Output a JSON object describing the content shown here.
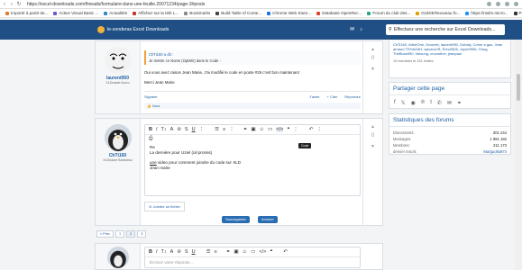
{
  "browser": {
    "url": "https://excel-downloads.com/threads/formulaire-dans-une-feuille.20071234/page-3#posts",
    "bookmarks": [
      {
        "label": "Importé à partir de...",
        "color": "#e07b2b"
      },
      {
        "label": "Active Visual Basic ...",
        "color": "#6a5acd"
      },
      {
        "label": "Actualités",
        "color": "#2d89c9"
      },
      {
        "label": "Affichez sur la télé L...",
        "color": "#c0392b"
      },
      {
        "label": "Bookmarks",
        "color": "#888888"
      },
      {
        "label": "Build Table of Conte...",
        "color": "#444444"
      },
      {
        "label": "Chrome Web Store...",
        "color": "#1a73e8"
      },
      {
        "label": "Database OpenRec...",
        "color": "#d43"
      },
      {
        "label": "Forum du club des...",
        "color": "#2a8"
      },
      {
        "label": "GUIDE/Nouveau fo...",
        "color": "#e2a300"
      },
      {
        "label": "https://mslm.micro...",
        "color": "#1e90ff"
      },
      {
        "label": "Professional Guide...",
        "color": "#333333"
      }
    ]
  },
  "header": {
    "site_name": "le-sonderas Excel Downloads",
    "search_placeholder": "Effectuez une recherche sur Excel Downloads..."
  },
  "post1": {
    "username": "laurent950",
    "user_title": "XLDnaute Accro",
    "quote_header": "ChTi160 a dit :",
    "quote_line1": "Je mettre ce Noms (OptMir) dans le Code :",
    "line2": "Oui vous avez raison Jean Marie, J'ai modifié le code en poste #26 c'est bon maintenant",
    "line3": "Merci Jean Marie",
    "actions": {
      "report": "Signaler",
      "like": "J'aime",
      "quote": "+ Citer",
      "reply": "Répondre"
    },
    "reaction": "Vous",
    "votes": "0"
  },
  "post2": {
    "username": "ChTi160",
    "user_title": "XLDnaute Barbatruc",
    "tooltip": "Code",
    "lines": [
      "Re",
      "La dernière pour Uziel (oil promis)",
      "",
      "une video pour comment joindre du code sur XLD",
      "Jean marie"
    ],
    "link_text": "une",
    "attach": "Joindre un fichier",
    "save": "Sauvegarder",
    "cancel": "Annuler",
    "votes": "0"
  },
  "pager": [
    "« Préc",
    "1",
    "2",
    "3"
  ],
  "reply_box": {
    "placeholder": "Écrivez votre réponse..."
  },
  "sidebar": {
    "members_online_text": "ChTi160, ArtheOne, Dranreb, laurent950, Dubaly, Corne a gaz, Jean arnaud TEHAZAH, sylvanu78, Erez2828, Jujue9956, Gnug, TheBoss990, hieoung, crocrotine, jeanpaul",
    "members_count": "19 membres et 151 invités",
    "share_title": "Partager cette page",
    "stats_title": "Statistiques des forums",
    "stats": [
      {
        "k": "Discussions:",
        "v": "301 244"
      },
      {
        "k": "Messages:",
        "v": "1 991 182"
      },
      {
        "k": "Membres:",
        "v": "211 173"
      },
      {
        "k": "dernier inscrit:",
        "v": "Marguoltu974"
      }
    ]
  },
  "colors": {
    "header": "#1f4f84",
    "accent": "#1f5fa5",
    "save": "#2a6db3",
    "cancel": "#2a6db3"
  }
}
